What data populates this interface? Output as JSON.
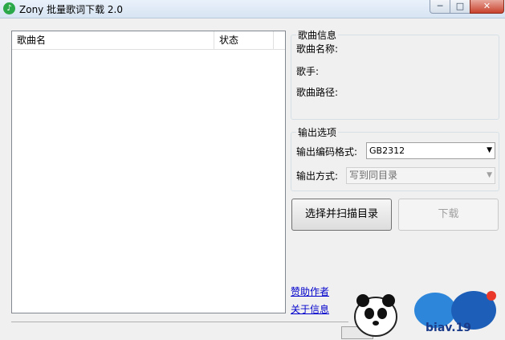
{
  "window": {
    "title": "Zony 批量歌词下载 2.0",
    "app_icon": "lyrics-app-icon",
    "controls": {
      "minimize": "─",
      "maximize": "□",
      "close": "✕"
    }
  },
  "song_list": {
    "columns": [
      "歌曲名",
      "状态"
    ],
    "rows": []
  },
  "song_info": {
    "group_title": "歌曲信息",
    "name_label": "歌曲名称:",
    "singer_label": "歌手:",
    "path_label": "歌曲路径:"
  },
  "output_options": {
    "group_title": "输出选项",
    "encoding_label": "输出编码格式:",
    "encoding_value": "GB2312",
    "mode_label": "输出方式:",
    "mode_value": "写到同目录"
  },
  "buttons": {
    "scan": "选择并扫描目录",
    "download": "下载"
  },
  "links": {
    "sponsor": "赞助作者",
    "about": "关于信息"
  },
  "watermark": {
    "text": "biav.19"
  },
  "colors": {
    "window_bg": "#f0f0f0",
    "link": "#0000cc",
    "close_button": "#c8422d"
  }
}
